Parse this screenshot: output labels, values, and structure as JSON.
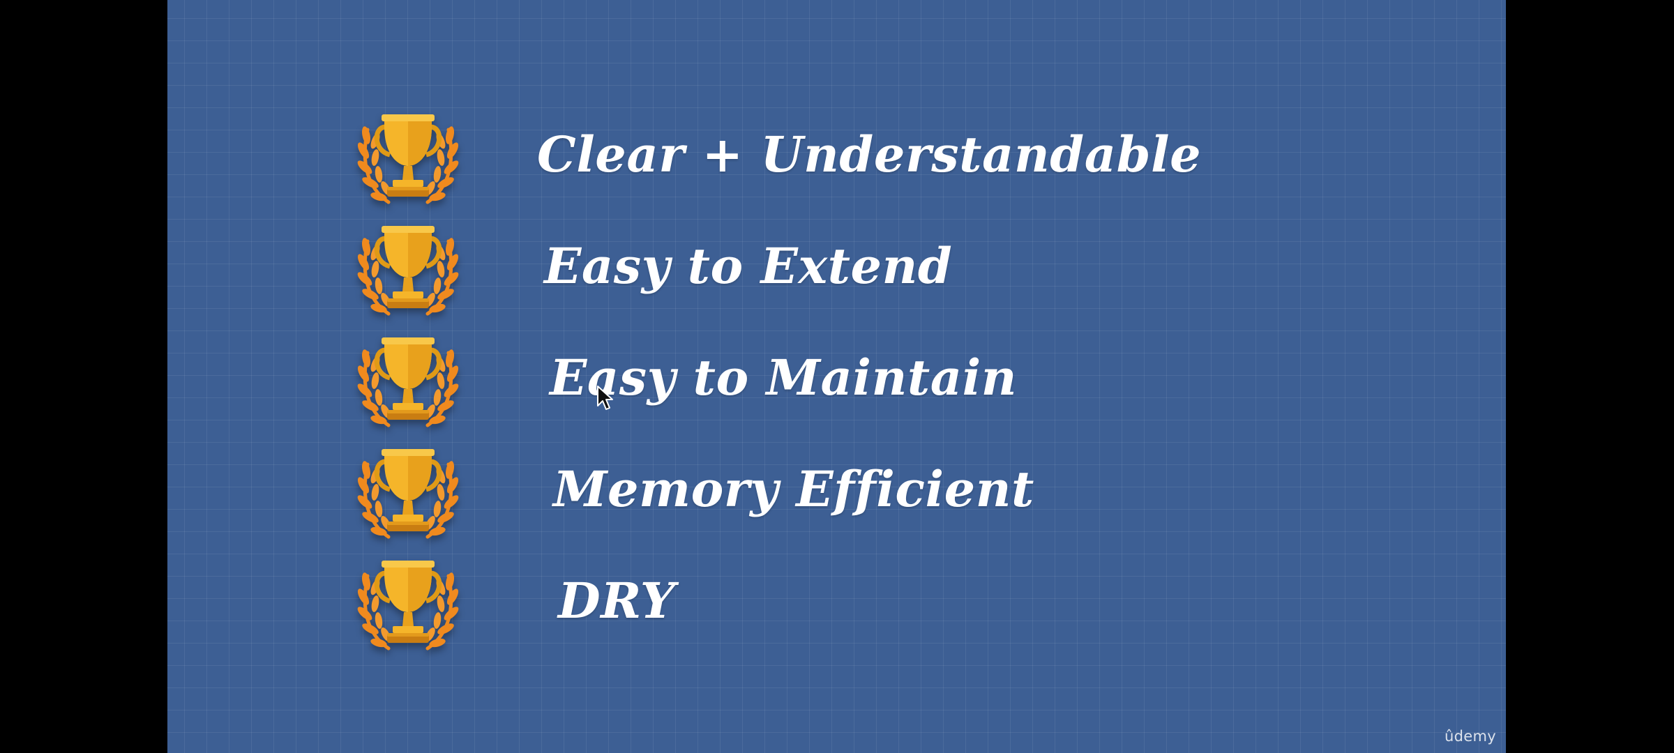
{
  "slide": {
    "items": [
      {
        "label": "Clear + Understandable",
        "icon": "trophy-laurel-icon"
      },
      {
        "label": "Easy to Extend",
        "icon": "trophy-laurel-icon"
      },
      {
        "label": "Easy to Maintain",
        "icon": "trophy-laurel-icon"
      },
      {
        "label": "Memory Efficient",
        "icon": "trophy-laurel-icon"
      },
      {
        "label": "DRY",
        "icon": "trophy-laurel-icon"
      }
    ],
    "watermark": "ûdemy"
  },
  "colors": {
    "background": "#3d5f94",
    "letterbox": "#000000",
    "text": "#ffffff",
    "trophy_gold": "#f5b52a",
    "laurel_orange": "#f08a1e"
  }
}
